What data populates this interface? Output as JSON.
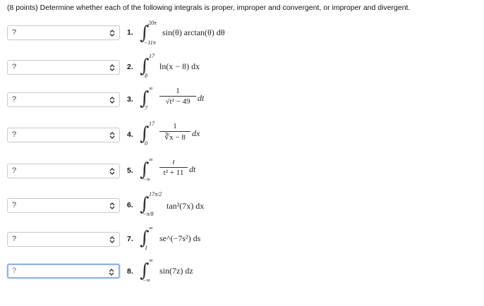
{
  "instruction": "(8 points) Determine whether each of the following integrals is proper, improper and convergent, or improper and divergent.",
  "integrals": [
    {
      "number": "1.",
      "selected": "?",
      "upper": "20π",
      "lower": "−11π",
      "integrand": "sin(θ) arctan(θ) dθ"
    },
    {
      "number": "2.",
      "selected": "?",
      "upper": "17",
      "lower": "8",
      "integrand": "ln(x − 8) dx"
    },
    {
      "number": "3.",
      "selected": "?",
      "upper": "∞",
      "lower": "7",
      "numerator": "1",
      "denominator": "√t² − 49",
      "differential": "dt"
    },
    {
      "number": "4.",
      "selected": "?",
      "upper": "17",
      "lower": "0",
      "numerator": "1",
      "denominator": "∛x − 8",
      "differential": "dx"
    },
    {
      "number": "5.",
      "selected": "?",
      "upper": "∞",
      "lower": "−∞",
      "numerator": "t",
      "denominator": "t² + 11",
      "differential": "dt"
    },
    {
      "number": "6.",
      "selected": "?",
      "upper": "17π/2",
      "lower": "−π/8",
      "integrand": "tan²(7x) dx"
    },
    {
      "number": "7.",
      "selected": "?",
      "upper": "∞",
      "lower": "1",
      "integrand": "se^(−7s²) ds"
    },
    {
      "number": "8.",
      "selected": "?",
      "upper": "∞",
      "lower": "−∞",
      "integrand": "sin(7z) dz"
    }
  ],
  "icons": {
    "select_arrow": "chevron-up-down-icon"
  }
}
